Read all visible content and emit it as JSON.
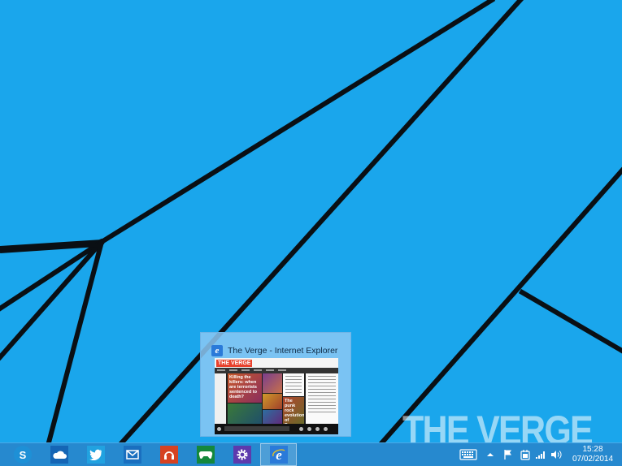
{
  "desktop": {
    "background_color": "#1aa6ec",
    "line_color": "#0a0f14"
  },
  "thumbnail": {
    "title": "The Verge - Internet Explorer",
    "icon": "internet-explorer-icon",
    "preview": {
      "site_logo": "THE VERGE",
      "headlines": [
        "Killing the killers: when are terrorists sentenced to death?",
        "The punk rock evolution of Pussy Riot comes to America"
      ]
    }
  },
  "taskbar": {
    "color": "#2689cf",
    "apps": [
      {
        "name": "skype-icon",
        "color": "#1e90d6"
      },
      {
        "name": "onedrive-icon",
        "color": "#1565b5"
      },
      {
        "name": "twitter-icon",
        "color": "#21a2e0"
      },
      {
        "name": "mail-icon",
        "color": "#1a6fbf"
      },
      {
        "name": "music-icon",
        "color": "#d64222"
      },
      {
        "name": "games-icon",
        "color": "#14883c"
      },
      {
        "name": "settings-icon",
        "color": "#5d3aad"
      },
      {
        "name": "internet-explorer-icon",
        "color": "#2a7ad9",
        "active": true
      }
    ],
    "tray": {
      "keyboard": "touch-keyboard-icon",
      "chevron": "show-hidden-icons-icon",
      "flag": "action-center-flag-icon",
      "power": "power-icon",
      "network": "network-signal-icon",
      "volume": "volume-icon"
    },
    "clock": {
      "time": "15:28",
      "date": "07/02/2014"
    }
  },
  "watermark": "THE VERGE"
}
